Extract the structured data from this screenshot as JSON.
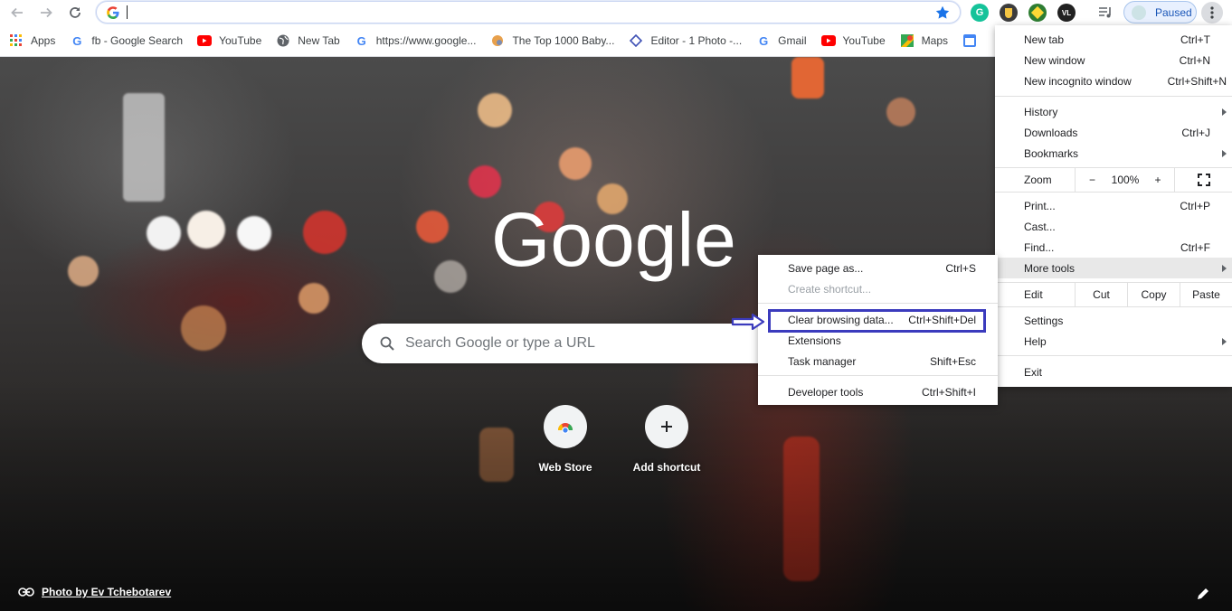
{
  "omnibox": {
    "value": ""
  },
  "profile": {
    "label": "Paused"
  },
  "bookmarks": [
    {
      "label": "Apps",
      "icon": "apps-grid-icon"
    },
    {
      "label": "fb - Google Search",
      "icon": "google-g-icon"
    },
    {
      "label": "YouTube",
      "icon": "youtube-icon"
    },
    {
      "label": "New Tab",
      "icon": "globe-icon"
    },
    {
      "label": "https://www.google...",
      "icon": "google-g-icon"
    },
    {
      "label": "The Top 1000 Baby...",
      "icon": "site-icon"
    },
    {
      "label": "Editor - 1 Photo -...",
      "icon": "editor-icon"
    },
    {
      "label": "Gmail",
      "icon": "google-g-icon"
    },
    {
      "label": "YouTube",
      "icon": "youtube-icon"
    },
    {
      "label": "Maps",
      "icon": "maps-icon"
    }
  ],
  "ntp": {
    "logo": "Google",
    "search_placeholder": "Search Google or type a URL",
    "shortcuts": [
      {
        "label": "Web Store",
        "icon": "webstore-icon"
      },
      {
        "label": "Add shortcut",
        "icon": "plus-icon"
      }
    ],
    "attribution": "Photo by Ev Tchebotarev"
  },
  "menu": {
    "new_tab": {
      "label": "New tab",
      "shortcut": "Ctrl+T"
    },
    "new_window": {
      "label": "New window",
      "shortcut": "Ctrl+N"
    },
    "new_incognito": {
      "label": "New incognito window",
      "shortcut": "Ctrl+Shift+N"
    },
    "history": {
      "label": "History"
    },
    "downloads": {
      "label": "Downloads",
      "shortcut": "Ctrl+J"
    },
    "bookmarks": {
      "label": "Bookmarks"
    },
    "zoom": {
      "label": "Zoom",
      "minus": "−",
      "value": "100%",
      "plus": "+"
    },
    "print": {
      "label": "Print...",
      "shortcut": "Ctrl+P"
    },
    "cast": {
      "label": "Cast..."
    },
    "find": {
      "label": "Find...",
      "shortcut": "Ctrl+F"
    },
    "more_tools": {
      "label": "More tools"
    },
    "edit": {
      "label": "Edit",
      "cut": "Cut",
      "copy": "Copy",
      "paste": "Paste"
    },
    "settings": {
      "label": "Settings"
    },
    "help": {
      "label": "Help"
    },
    "exit": {
      "label": "Exit"
    }
  },
  "submenu": {
    "save_page": {
      "label": "Save page as...",
      "shortcut": "Ctrl+S"
    },
    "create_shortcut": {
      "label": "Create shortcut..."
    },
    "clear_data": {
      "label": "Clear browsing data...",
      "shortcut": "Ctrl+Shift+Del"
    },
    "extensions": {
      "label": "Extensions"
    },
    "task_manager": {
      "label": "Task manager",
      "shortcut": "Shift+Esc"
    },
    "dev_tools": {
      "label": "Developer tools",
      "shortcut": "Ctrl+Shift+I"
    }
  },
  "colors": {
    "annotation": "#3b3bbd",
    "accent": "#1a73e8"
  }
}
